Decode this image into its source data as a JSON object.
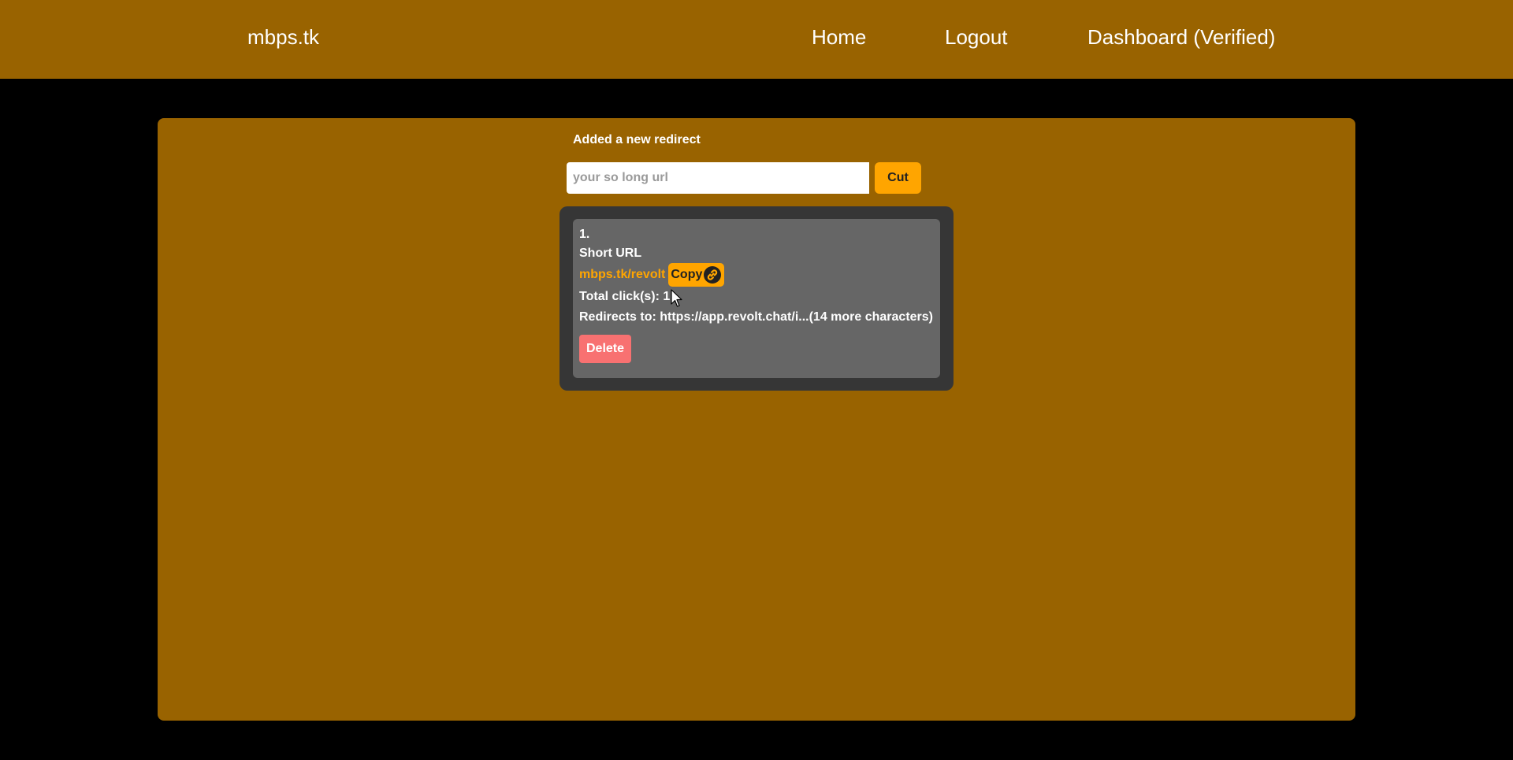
{
  "header": {
    "brand": "mbps.tk",
    "nav": {
      "home": "Home",
      "logout": "Logout",
      "dashboard": "Dashboard (Verified)"
    },
    "background_color": "#996300"
  },
  "main": {
    "status_message": "Added a new redirect",
    "url_input": {
      "placeholder": "your so long url",
      "value": ""
    },
    "cut_button_label": "Cut",
    "redirects": [
      {
        "index": "1.",
        "short_url_label": "Short URL",
        "short_url": "mbps.tk/revolt",
        "copy_label": "Copy",
        "clicks_text": "Total click(s): 1",
        "redirect_text": "Redirects to: https://app.revolt.chat/i...(14 more characters)",
        "delete_label": "Delete"
      }
    ]
  },
  "colors": {
    "page_background": "#000000",
    "accent": "#ffa500",
    "card": "#666666",
    "list_container": "#363636",
    "danger": "#f87171"
  },
  "icons": {
    "copy": "link-icon",
    "pointer": "cursor-icon"
  }
}
